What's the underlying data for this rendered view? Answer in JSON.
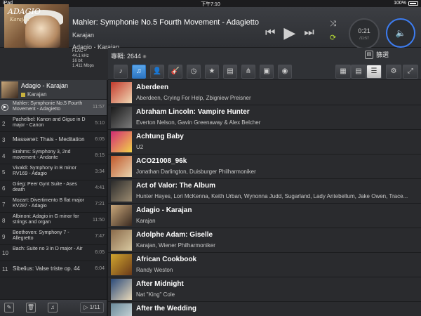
{
  "status_bar": {
    "device": "iPad",
    "time": "下午7:10",
    "battery": "100%"
  },
  "now_playing": {
    "title": "Mahler: Symphonie No.5 Fourth Movement - Adagietto",
    "artist": "Karajan",
    "album": "Adagio - Karajan",
    "cover_title": "ADAGIO",
    "cover_subtitle": "Karajan",
    "format_lines": [
      "FLAC",
      "44.1 kHz",
      "16 bit",
      "1.411 Mbps"
    ],
    "elapsed": "0:21",
    "duration": "/11:57"
  },
  "toolbar": {
    "album_count": "專輯: 2644",
    "filter_label": "篩選",
    "category_icons": [
      "music-note-icon",
      "album-icon",
      "artist-icon",
      "guitar-icon",
      "clock-icon",
      "folder-star-icon",
      "folder-icon",
      "network-icon",
      "device-icon",
      "radio-icon"
    ],
    "category_glyphs": [
      "♪",
      "♫",
      "👤",
      "🎸",
      "◷",
      "★",
      "▤",
      "⋔",
      "▣",
      "◉"
    ],
    "view_glyphs": [
      "▦",
      "▤",
      "☰"
    ],
    "settings_glyph": "⚙",
    "fullscreen_glyph": "⤢"
  },
  "queue_album": {
    "name": "Adagio - Karajan",
    "artist": "Karajan"
  },
  "queue": [
    {
      "num": "",
      "title": "Mahler: Symphonie No.5 Fourth Movement - Adagietto",
      "duration": "11:57"
    },
    {
      "num": "2",
      "title": "Pachelbel: Kanon and Gigue in D major - Canon",
      "duration": "5:10"
    },
    {
      "num": "3",
      "title": "Massenet: Thais - Meditation",
      "duration": "6:05"
    },
    {
      "num": "4",
      "title": "Brahms: Symphony 3, 2nd movement - Andante",
      "duration": "8:15"
    },
    {
      "num": "5",
      "title": "Vivaldi: Symphony in B minor RV169 - Adagio",
      "duration": "3:34"
    },
    {
      "num": "6",
      "title": "Grieg: Peer Gynt Suite - Ases death",
      "duration": "4:41"
    },
    {
      "num": "7",
      "title": "Mozart: Divertimento B flat major KV287 - Adagio",
      "duration": "7:21"
    },
    {
      "num": "8",
      "title": "Albinoni: Adagio in G minor for strings and organ",
      "duration": "11:50"
    },
    {
      "num": "9",
      "title": "Beethoven: Symphony 7 - Allegretto",
      "duration": "7:47"
    },
    {
      "num": "10",
      "title": "Bach: Suite no 3 in D major - Air",
      "duration": "6:05"
    },
    {
      "num": "11",
      "title": "Sibelius: Valse triste op. 44",
      "duration": "6:04"
    }
  ],
  "pager": "1/11",
  "albums": [
    {
      "name": "Aberdeen",
      "artists": "Aberdeen, Crying For Help, Zbigniew Preisner",
      "color_a": "#c43a2c",
      "color_b": "#f0d9b5"
    },
    {
      "name": "Abraham Lincoln: Vampire Hunter",
      "artists": "Everton Nelson, Gavin Greenaway & Alex Belcher",
      "color_a": "#1a1a1a",
      "color_b": "#7a7a7a"
    },
    {
      "name": "Achtung Baby",
      "artists": "U2",
      "color_a": "#d12b73",
      "color_b": "#f2d24a"
    },
    {
      "name": "ACO21008_96k",
      "artists": "Jonathan Darlington, Duisburger Philharmoniker",
      "color_a": "#c0572a",
      "color_b": "#e9d5b0"
    },
    {
      "name": "Act of Valor: The Album",
      "artists": "Hunter Hayes, Lori McKenna, Keith Urban, Wynonna Judd, Sugarland, Lady Antebellum, Jake Owen, Trace...",
      "color_a": "#2a2a2a",
      "color_b": "#9a8a70"
    },
    {
      "name": "Adagio - Karajan",
      "artists": "Karajan",
      "color_a": "#c9a77a",
      "color_b": "#3a2a20"
    },
    {
      "name": "Adolphe Adam: Giselle",
      "artists": "Karajan, Wiener Philharmoniker",
      "color_a": "#8a6a4a",
      "color_b": "#d8c8a0"
    },
    {
      "name": "African Cookbook",
      "artists": "Randy Weston",
      "color_a": "#d1a52e",
      "color_b": "#6a3a1a"
    },
    {
      "name": "After Midnight",
      "artists": "Nat \"King\" Cole",
      "color_a": "#2a4a7a",
      "color_b": "#e8d8b8"
    },
    {
      "name": "After the Wedding",
      "artists": "",
      "color_a": "#6a8a9a",
      "color_b": "#d8e0e0"
    }
  ]
}
